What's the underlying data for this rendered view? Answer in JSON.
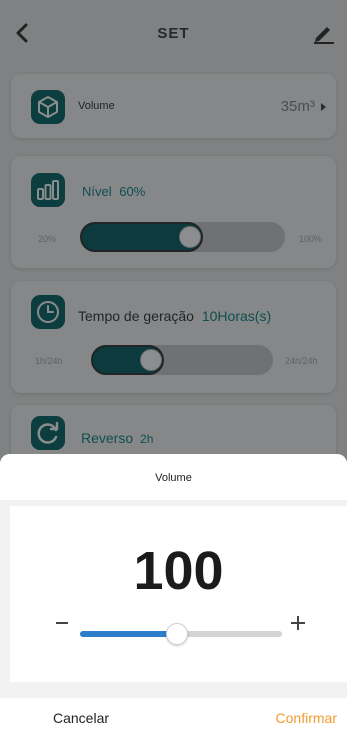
{
  "header": {
    "title": "SET",
    "back_icon": "chevron-left-icon",
    "edit_icon": "pencil-icon"
  },
  "volume_card": {
    "label": "Volume",
    "value": "35m³",
    "icon": "cube-icon",
    "arrow_icon": "chevron-right-icon"
  },
  "level_card": {
    "label": "Nível",
    "value": "60%",
    "min_label": "20%",
    "max_label": "100%",
    "slider_fraction": 0.6,
    "icon": "bar-chart-icon"
  },
  "time_card": {
    "label": "Tempo de geração",
    "value": "10Horas(s)",
    "min_label": "1h/24h",
    "max_label": "24h/24h",
    "slider_fraction": 0.4,
    "icon": "clock-icon"
  },
  "reverse_card": {
    "label": "Reverso",
    "value": "2h",
    "icon": "refresh-icon"
  },
  "sheet": {
    "title": "Volume",
    "value": "100",
    "slider_fraction": 0.48,
    "minus_icon": "minus-icon",
    "plus_icon": "plus-icon",
    "cancel_label": "Cancelar",
    "confirm_label": "Confirmar"
  },
  "colors": {
    "accent": "#0d3b3d",
    "slider_blue": "#2b7fca",
    "confirm_orange": "#f29a2e"
  }
}
